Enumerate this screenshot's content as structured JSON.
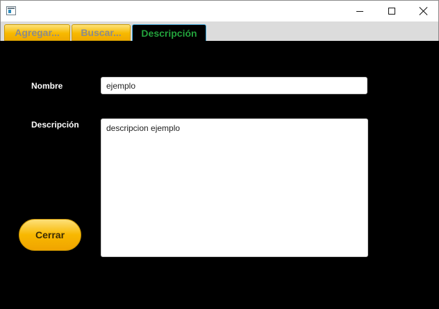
{
  "tabs": [
    {
      "label": "Agregar..."
    },
    {
      "label": "Buscar..."
    },
    {
      "label": "Descripción"
    }
  ],
  "form": {
    "nombre_label": "Nombre",
    "nombre_value": "ejemplo",
    "descripcion_label": "Descripción",
    "descripcion_value": "descripcion ejemplo",
    "close_label": "Cerrar"
  },
  "colors": {
    "background": "#000000",
    "tab_accent": "#f7b900",
    "active_tab_text": "#23a23c",
    "active_tab_border": "#3aa4d6"
  }
}
